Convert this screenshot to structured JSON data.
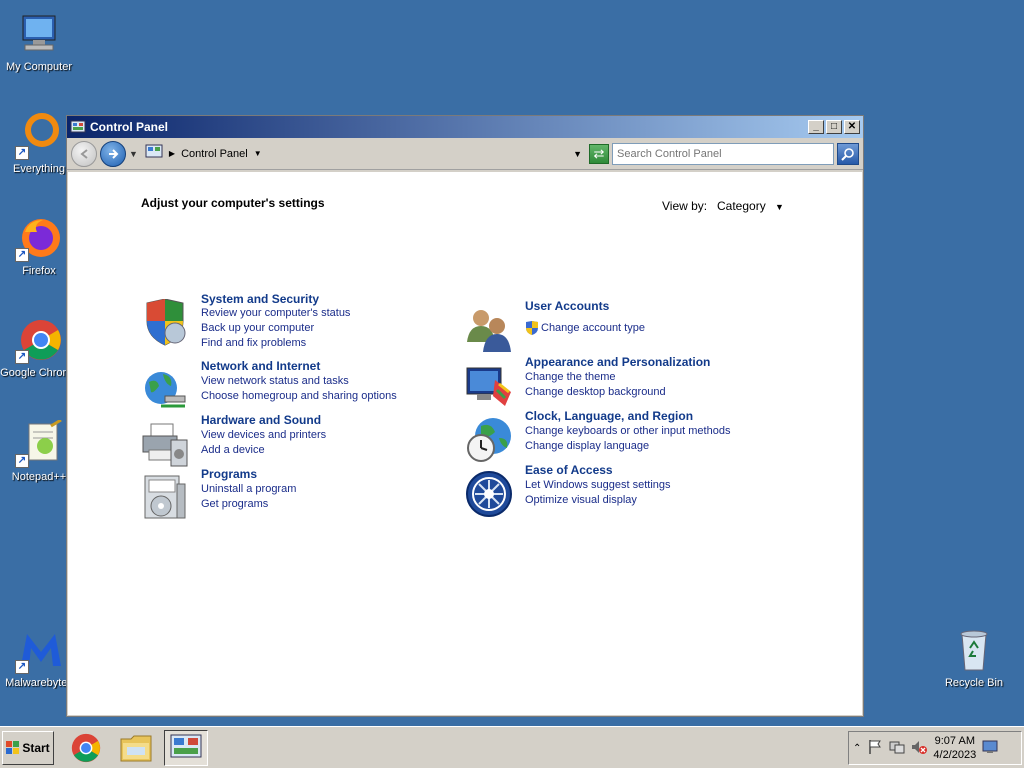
{
  "desktop": {
    "icons": [
      {
        "label": "My Computer"
      },
      {
        "label": "Everything"
      },
      {
        "label": "Firefox"
      },
      {
        "label": "Google Chrome"
      },
      {
        "label": "Notepad++"
      },
      {
        "label": "Malwarebytes"
      },
      {
        "label": "Recycle Bin"
      }
    ]
  },
  "window": {
    "title": "Control Panel",
    "address": "Control Panel",
    "search_placeholder": "Search Control Panel",
    "minimize": "_",
    "maximize": "□",
    "close": "✕"
  },
  "content": {
    "heading": "Adjust your computer's settings",
    "view_by_label": "View by:",
    "view_by_value": "Category",
    "left": [
      {
        "title": "System and Security",
        "links": [
          "Review your computer's status",
          "Back up your computer",
          "Find and fix problems"
        ]
      },
      {
        "title": "Network and Internet",
        "links": [
          "View network status and tasks",
          "Choose homegroup and sharing options"
        ]
      },
      {
        "title": "Hardware and Sound",
        "links": [
          "View devices and printers",
          "Add a device"
        ]
      },
      {
        "title": "Programs",
        "links": [
          "Uninstall a program",
          "Get programs"
        ]
      }
    ],
    "right": [
      {
        "title": "User Accounts",
        "links": [
          "Change account type"
        ]
      },
      {
        "title": "Appearance and Personalization",
        "links": [
          "Change the theme",
          "Change desktop background"
        ]
      },
      {
        "title": "Clock, Language, and Region",
        "links": [
          "Change keyboards or other input methods",
          "Change display language"
        ]
      },
      {
        "title": "Ease of Access",
        "links": [
          "Let Windows suggest settings",
          "Optimize visual display"
        ]
      }
    ]
  },
  "taskbar": {
    "start_label": "Start",
    "time": "9:07 AM",
    "date": "4/2/2023"
  }
}
